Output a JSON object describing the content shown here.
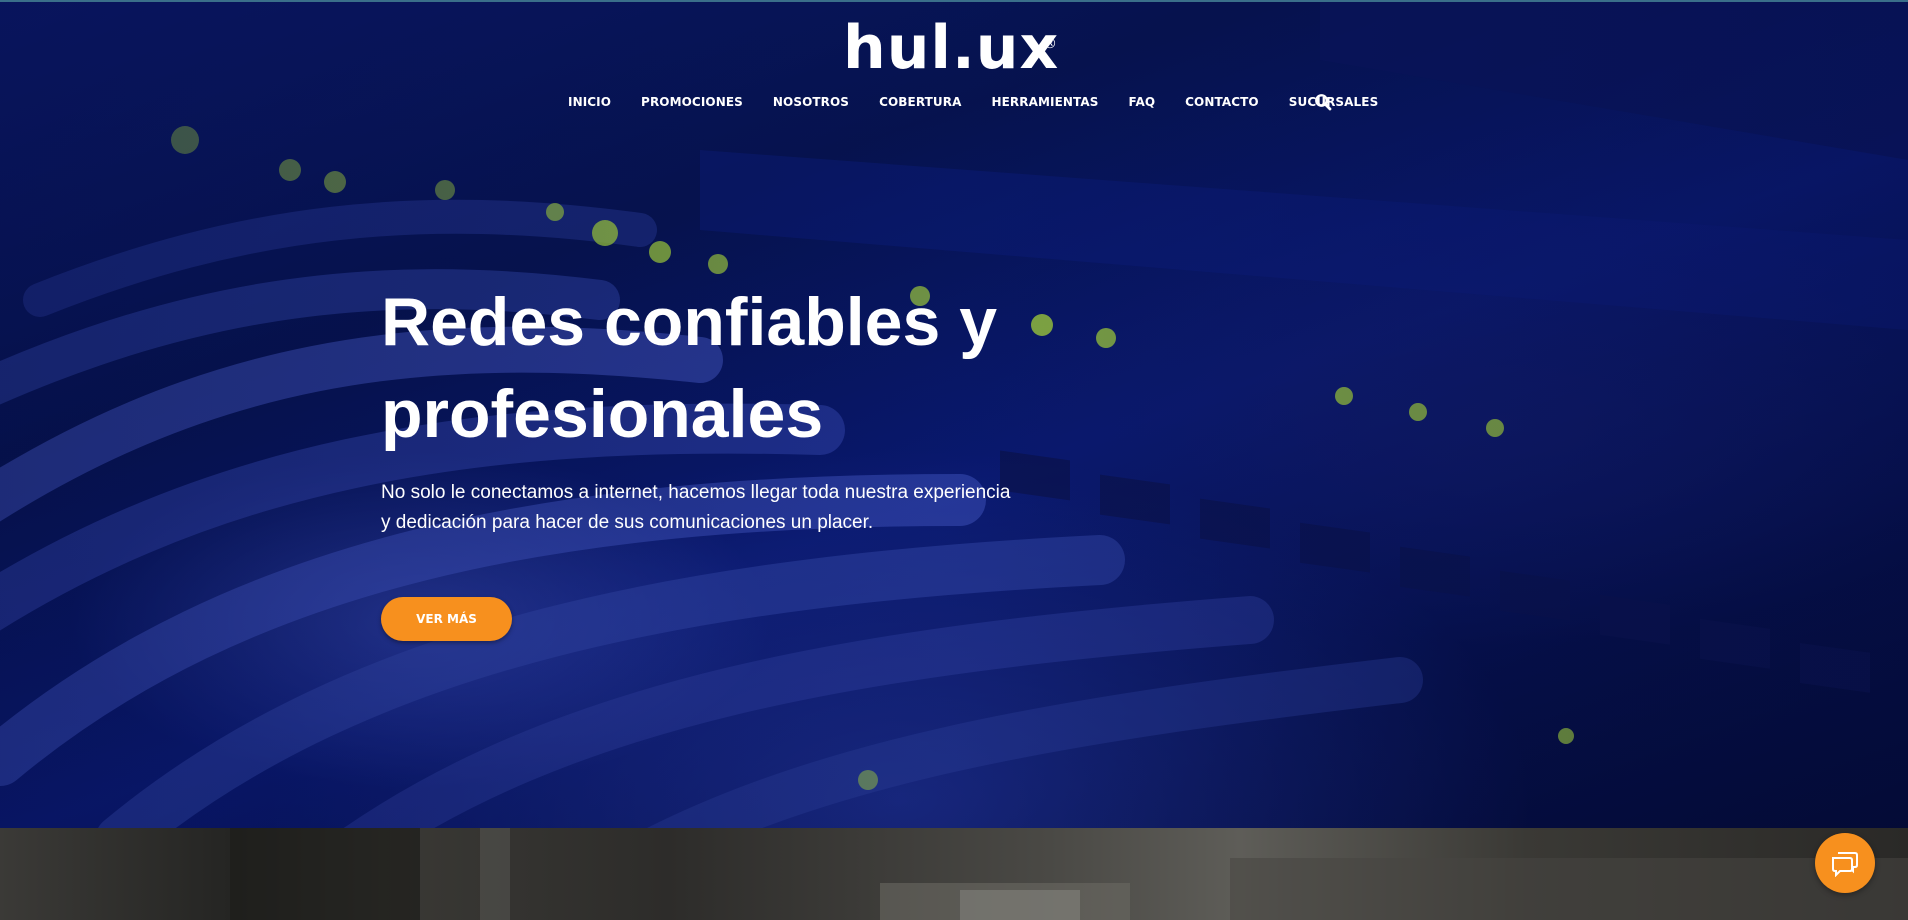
{
  "brand": {
    "logo_text": "hul.ux",
    "registered_mark": "®",
    "accent_color": "#f7901e"
  },
  "nav": {
    "items": [
      {
        "label": "INICIO"
      },
      {
        "label": "PROMOCIONES"
      },
      {
        "label": "NOSOTROS"
      },
      {
        "label": "COBERTURA"
      },
      {
        "label": "HERRAMIENTAS"
      },
      {
        "label": "FAQ"
      },
      {
        "label": "CONTACTO"
      },
      {
        "label": "SUCURSALES"
      }
    ],
    "search_icon": "search-icon"
  },
  "hero": {
    "title": "Redes confiables y profesionales",
    "subtitle": "No solo le conectamos a internet, hacemos llegar toda nuestra experiencia y dedicación para hacer de sus comunicaciones un placer.",
    "cta_label": "VER MÁS"
  },
  "chat": {
    "icon": "chat-icon"
  }
}
